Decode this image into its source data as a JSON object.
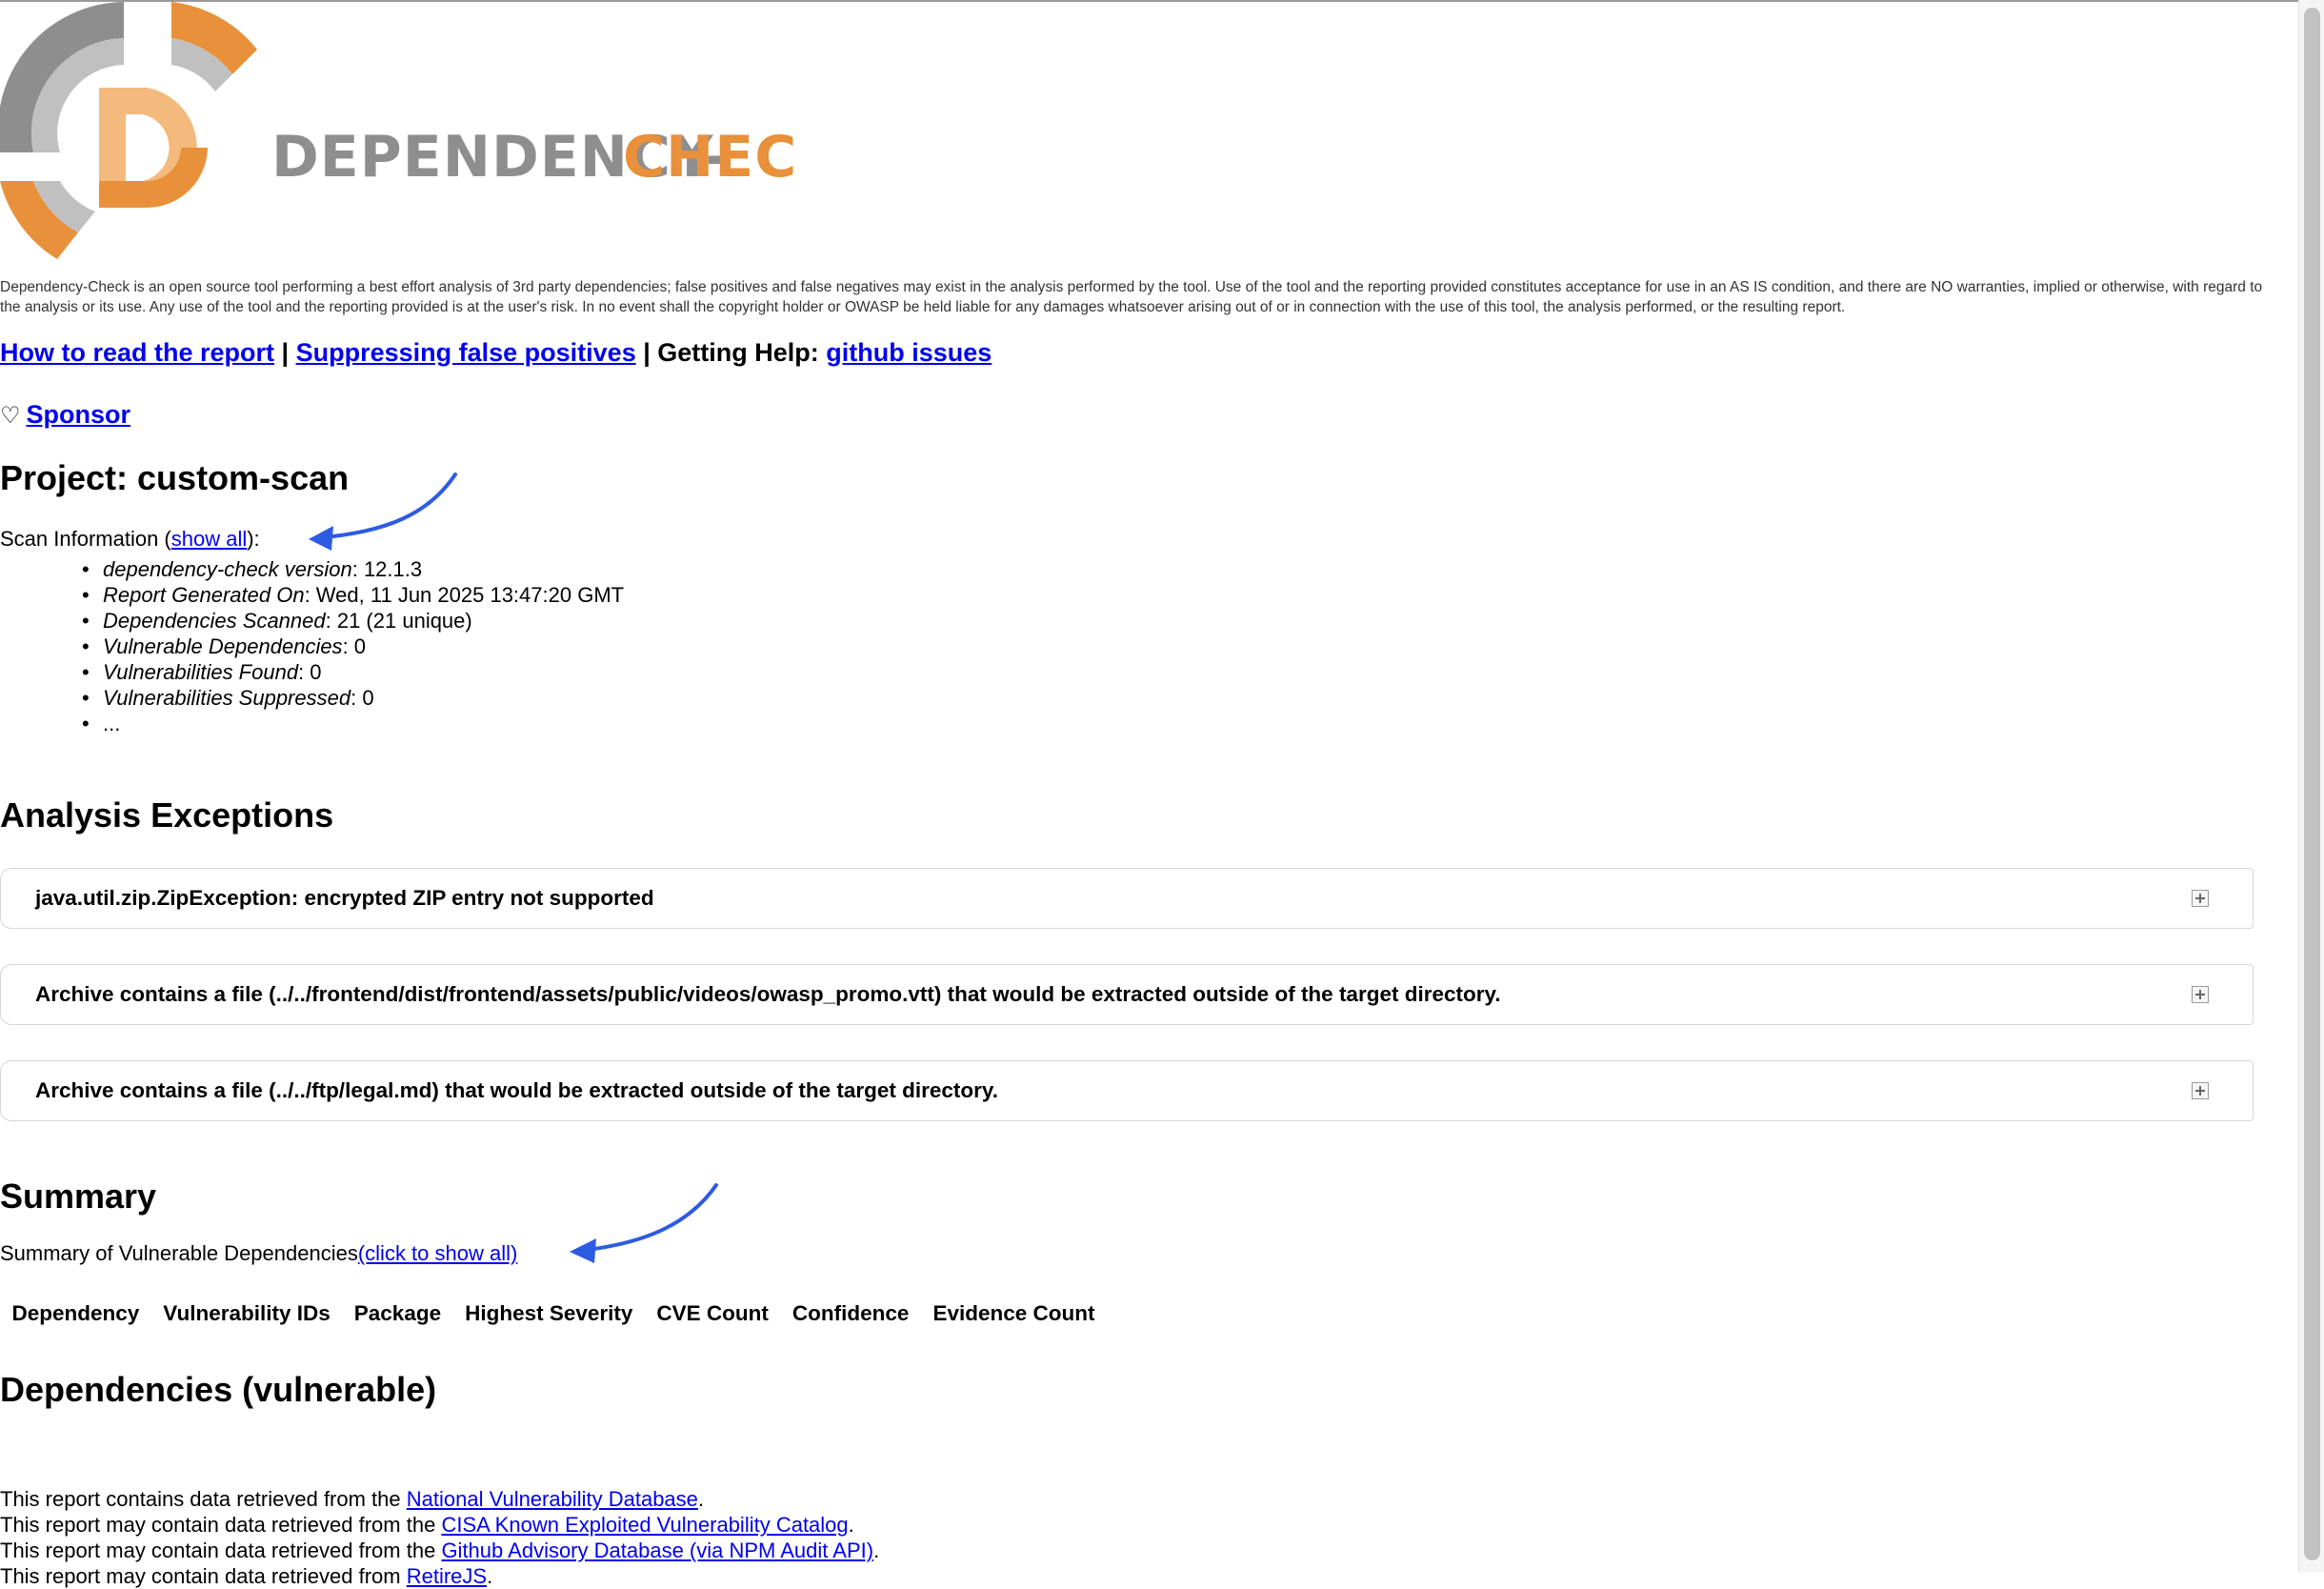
{
  "logo": {
    "letter": "D",
    "word1": "DEPENDENCY-",
    "word2": "CHECK",
    "colors": {
      "gray": "#8e8e8e",
      "lightgray": "#c0c0c0",
      "orange": "#e8903a",
      "lightorange": "#f3b97d"
    }
  },
  "disclaimer": "Dependency-Check is an open source tool performing a best effort analysis of 3rd party dependencies; false positives and false negatives may exist in the analysis performed by the tool. Use of the tool and the reporting provided constitutes acceptance for use in an AS IS condition, and there are NO warranties, implied or otherwise, with regard to the analysis or its use. Any use of the tool and the reporting provided is at the user's risk. In no event shall the copyright holder or OWASP be held liable for any damages whatsoever arising out of or in connection with the use of this tool, the analysis performed, or the resulting report.",
  "help": {
    "read_report": "How to read the report",
    "sep1": " | ",
    "suppress": "Suppressing false positives",
    "sep2": " | Getting Help: ",
    "github": "github issues"
  },
  "sponsor": {
    "icon": "heart-icon",
    "label": "Sponsor"
  },
  "project_title": "Project: custom-scan",
  "scan_info": {
    "prefix": "Scan Information (",
    "show_all": "show all",
    "suffix": "):",
    "items": [
      {
        "key": "dependency-check version",
        "value": ": 12.1.3"
      },
      {
        "key": "Report Generated On",
        "value": ": Wed, 11 Jun 2025 13:47:20 GMT"
      },
      {
        "key": "Dependencies Scanned",
        "value": ": 21 (21 unique)"
      },
      {
        "key": "Vulnerable Dependencies",
        "value": ": 0"
      },
      {
        "key": "Vulnerabilities Found",
        "value": ": 0"
      },
      {
        "key": "Vulnerabilities Suppressed",
        "value": ": 0"
      },
      {
        "key": "",
        "value": "..."
      }
    ]
  },
  "exceptions": {
    "title": "Analysis Exceptions",
    "items": [
      "java.util.zip.ZipException: encrypted ZIP entry not supported",
      "Archive contains a file (../../frontend/dist/frontend/assets/public/videos/owasp_promo.vtt) that would be extracted outside of the target directory.",
      "Archive contains a file (../../ftp/legal.md) that would be extracted outside of the target directory."
    ]
  },
  "summary": {
    "title": "Summary",
    "text": "Summary of Vulnerable Dependencies",
    "show_all": "(click to show all)",
    "columns": [
      "Dependency",
      "Vulnerability IDs",
      "Package",
      "Highest Severity",
      "CVE Count",
      "Confidence",
      "Evidence Count"
    ]
  },
  "deps_title": "Dependencies (vulnerable)",
  "sources": [
    {
      "prefix": "This report contains data retrieved from the ",
      "link": "National Vulnerability Database",
      "suffix": "."
    },
    {
      "prefix": "This report may contain data retrieved from the ",
      "link": "CISA Known Exploited Vulnerability Catalog",
      "suffix": "."
    },
    {
      "prefix": "This report may contain data retrieved from the ",
      "link": "Github Advisory Database (via NPM Audit API)",
      "suffix": "."
    },
    {
      "prefix": "This report may contain data retrieved from ",
      "link": "RetireJS",
      "suffix": "."
    }
  ],
  "annotation_color": "#2d5be3"
}
